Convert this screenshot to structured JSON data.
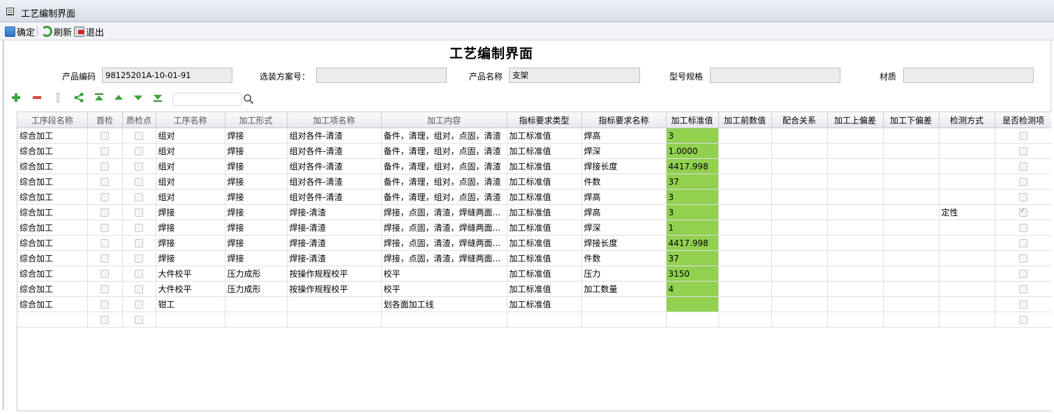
{
  "window": {
    "title": "工艺编制界面"
  },
  "toolbar": {
    "confirm": "确定",
    "refresh": "刷新",
    "exit": "退出"
  },
  "page": {
    "heading": "工艺编制界面"
  },
  "form": {
    "product_code_label": "产品编码",
    "product_code_value": "98125201A-10-01-91",
    "scheme_label": "选装方案号：",
    "scheme_value": "",
    "product_name_label": "产品名称",
    "product_name_value": "支架",
    "model_label": "型号规格",
    "model_value": "",
    "material_label": "材质",
    "material_value": ""
  },
  "grid_toolbar": {
    "search_placeholder": ""
  },
  "colors": {
    "highlight": "#92d050"
  },
  "table": {
    "headers": [
      "工序段名称",
      "首检",
      "质检点",
      "工序名称",
      "加工形式",
      "加工项名称",
      "加工内容",
      "指标要求类型",
      "指标要求名称",
      "加工标准值",
      "加工前数值",
      "配合关系",
      "加工上偏差",
      "加工下偏差",
      "检测方式",
      "是否检测项"
    ],
    "rows": [
      {
        "stage": "综合加工",
        "first": false,
        "qc": false,
        "proc": "组对",
        "form": "焊接",
        "item": "组对各件-清渣",
        "content": "备件，清理，组对，点固，清渣",
        "req_type": "加工标准值",
        "req_name": "焊高",
        "std": "3",
        "before": "",
        "fit": "",
        "upper": "",
        "lower": "",
        "method": "",
        "inspect": false
      },
      {
        "stage": "综合加工",
        "first": false,
        "qc": false,
        "proc": "组对",
        "form": "焊接",
        "item": "组对各件-清渣",
        "content": "备件，清理，组对，点固，清渣",
        "req_type": "加工标准值",
        "req_name": "焊深",
        "std": "1.0000",
        "before": "",
        "fit": "",
        "upper": "",
        "lower": "",
        "method": "",
        "inspect": false
      },
      {
        "stage": "综合加工",
        "first": false,
        "qc": false,
        "proc": "组对",
        "form": "焊接",
        "item": "组对各件-清渣",
        "content": "备件，清理，组对，点固，清渣",
        "req_type": "加工标准值",
        "req_name": "焊接长度",
        "std": "4417.998",
        "before": "",
        "fit": "",
        "upper": "",
        "lower": "",
        "method": "",
        "inspect": false
      },
      {
        "stage": "综合加工",
        "first": false,
        "qc": false,
        "proc": "组对",
        "form": "焊接",
        "item": "组对各件-清渣",
        "content": "备件，清理，组对，点固，清渣",
        "req_type": "加工标准值",
        "req_name": "件数",
        "std": "37",
        "before": "",
        "fit": "",
        "upper": "",
        "lower": "",
        "method": "",
        "inspect": false
      },
      {
        "stage": "综合加工",
        "first": false,
        "qc": false,
        "proc": "组对",
        "form": "焊接",
        "item": "组对各件-清渣",
        "content": "备件，清理，组对，点固，清渣",
        "req_type": "加工标准值",
        "req_name": "焊高",
        "std": "3",
        "before": "",
        "fit": "",
        "upper": "",
        "lower": "",
        "method": "",
        "inspect": false
      },
      {
        "stage": "综合加工",
        "first": false,
        "qc": false,
        "proc": "焊接",
        "form": "焊接",
        "item": "焊接-清渣",
        "content": "焊接，点固，清渣，焊缝两面...",
        "req_type": "加工标准值",
        "req_name": "焊高",
        "std": "3",
        "before": "",
        "fit": "",
        "upper": "",
        "lower": "",
        "method": "定性",
        "inspect": true
      },
      {
        "stage": "综合加工",
        "first": false,
        "qc": false,
        "proc": "焊接",
        "form": "焊接",
        "item": "焊接-清渣",
        "content": "焊接，点固，清渣，焊缝两面...",
        "req_type": "加工标准值",
        "req_name": "焊深",
        "std": "1",
        "before": "",
        "fit": "",
        "upper": "",
        "lower": "",
        "method": "",
        "inspect": false
      },
      {
        "stage": "综合加工",
        "first": false,
        "qc": false,
        "proc": "焊接",
        "form": "焊接",
        "item": "焊接-清渣",
        "content": "焊接，点固，清渣，焊缝两面...",
        "req_type": "加工标准值",
        "req_name": "焊接长度",
        "std": "4417.998",
        "before": "",
        "fit": "",
        "upper": "",
        "lower": "",
        "method": "",
        "inspect": false
      },
      {
        "stage": "综合加工",
        "first": false,
        "qc": false,
        "proc": "焊接",
        "form": "焊接",
        "item": "焊接-清渣",
        "content": "焊接，点固，清渣，焊缝两面...",
        "req_type": "加工标准值",
        "req_name": "件数",
        "std": "37",
        "before": "",
        "fit": "",
        "upper": "",
        "lower": "",
        "method": "",
        "inspect": false
      },
      {
        "stage": "综合加工",
        "first": false,
        "qc": false,
        "proc": "大件校平",
        "form": "压力成形",
        "item": "按操作规程校平",
        "content": "校平",
        "req_type": "加工标准值",
        "req_name": "压力",
        "std": "3150",
        "before": "",
        "fit": "",
        "upper": "",
        "lower": "",
        "method": "",
        "inspect": false
      },
      {
        "stage": "综合加工",
        "first": false,
        "qc": false,
        "proc": "大件校平",
        "form": "压力成形",
        "item": "按操作规程校平",
        "content": "校平",
        "req_type": "加工标准值",
        "req_name": "加工数量",
        "std": "4",
        "before": "",
        "fit": "",
        "upper": "",
        "lower": "",
        "method": "",
        "inspect": false
      },
      {
        "stage": "综合加工",
        "first": false,
        "qc": false,
        "proc": "钳工",
        "form": "",
        "item": "",
        "content": "划各面加工线",
        "req_type": "加工标准值",
        "req_name": "",
        "std": "",
        "before": "",
        "fit": "",
        "upper": "",
        "lower": "",
        "method": "",
        "inspect": false
      },
      {
        "stage": "",
        "first": false,
        "qc": false,
        "proc": "",
        "form": "",
        "item": "",
        "content": "",
        "req_type": "",
        "req_name": "",
        "std": "",
        "before": "",
        "fit": "",
        "upper": "",
        "lower": "",
        "method": "",
        "inspect": false
      }
    ]
  }
}
